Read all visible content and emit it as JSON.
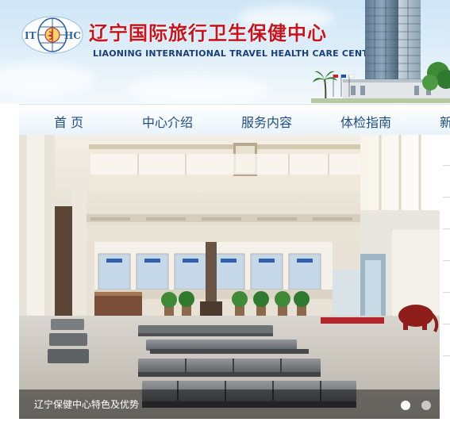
{
  "header": {
    "logo_text": "IT⚕HC",
    "title_cn": "辽宁国际旅行卫生保健中心",
    "title_en": "LIAONING INTERNATIONAL TRAVEL HEALTH CARE CENTER"
  },
  "nav": {
    "items": [
      {
        "label": "首 页"
      },
      {
        "label": "中心介绍"
      },
      {
        "label": "服务内容"
      },
      {
        "label": "体检指南"
      },
      {
        "label": "新"
      }
    ]
  },
  "banner": {
    "caption": "辽宁保健中心特色及优势",
    "slides_total": 2,
    "active_slide": 1
  },
  "colors": {
    "title_red": "#c8141e",
    "title_blue": "#1a3f7a",
    "nav_text": "#1f4f82"
  }
}
